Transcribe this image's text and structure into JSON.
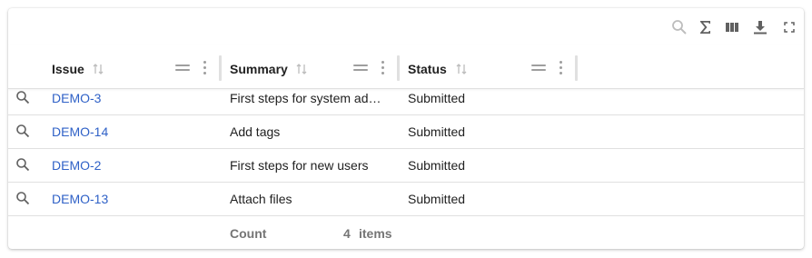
{
  "toolbar": {
    "icons": [
      "search-icon",
      "sum-icon",
      "columns-icon",
      "download-icon",
      "fullscreen-icon"
    ]
  },
  "columns": [
    {
      "label": "Issue"
    },
    {
      "label": "Summary"
    },
    {
      "label": "Status"
    }
  ],
  "rows": [
    {
      "issue": "DEMO-3",
      "summary": "First steps for system ad…",
      "status": "Submitted"
    },
    {
      "issue": "DEMO-14",
      "summary": "Add tags",
      "status": "Submitted"
    },
    {
      "issue": "DEMO-2",
      "summary": "First steps for new users",
      "status": "Submitted"
    },
    {
      "issue": "DEMO-13",
      "summary": "Attach files",
      "status": "Submitted"
    }
  ],
  "footer": {
    "count_label": "Count",
    "count_value": "4",
    "count_unit": "items"
  },
  "colors": {
    "link": "#2f61c7",
    "icon": "#616161",
    "border": "#e0e0e0"
  }
}
